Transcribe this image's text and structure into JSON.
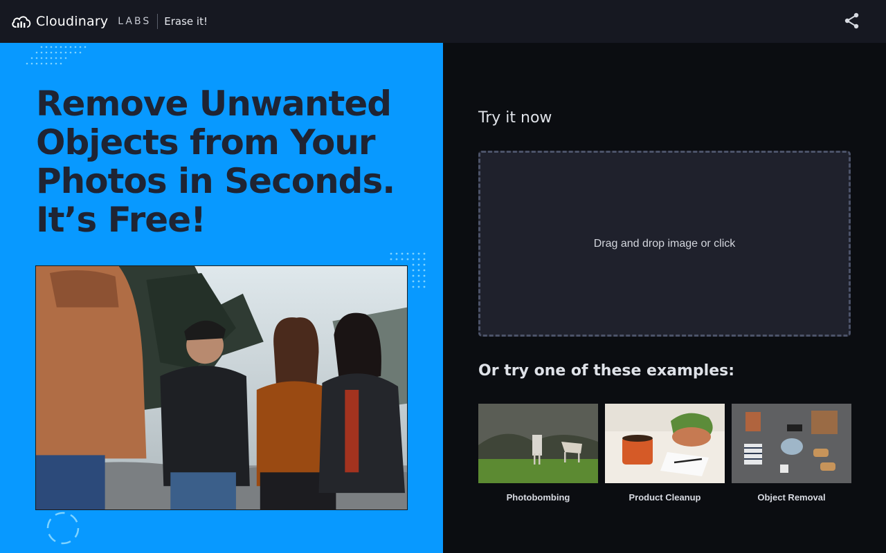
{
  "header": {
    "brand": "Cloudinary",
    "labs": "LABS",
    "product": "Erase it!",
    "share_icon": "share-icon"
  },
  "hero": {
    "headline_lines": [
      "Remove Unwanted",
      "Objects from Your",
      "Photos in Seconds.",
      "It’s Free!"
    ]
  },
  "try": {
    "title": "Try it now",
    "dropzone_text": "Drag and drop image or click"
  },
  "examples": {
    "title": "Or try one of these examples:",
    "items": [
      {
        "label": "Photobombing"
      },
      {
        "label": "Product Cleanup"
      },
      {
        "label": "Object Removal"
      }
    ]
  },
  "colors": {
    "left_bg": "#0899ff",
    "right_bg": "#0b0d11",
    "header_bg": "#161821",
    "headline": "#1f2433",
    "dropzone_bg": "#1f212c",
    "dropzone_border": "#4c5369"
  }
}
